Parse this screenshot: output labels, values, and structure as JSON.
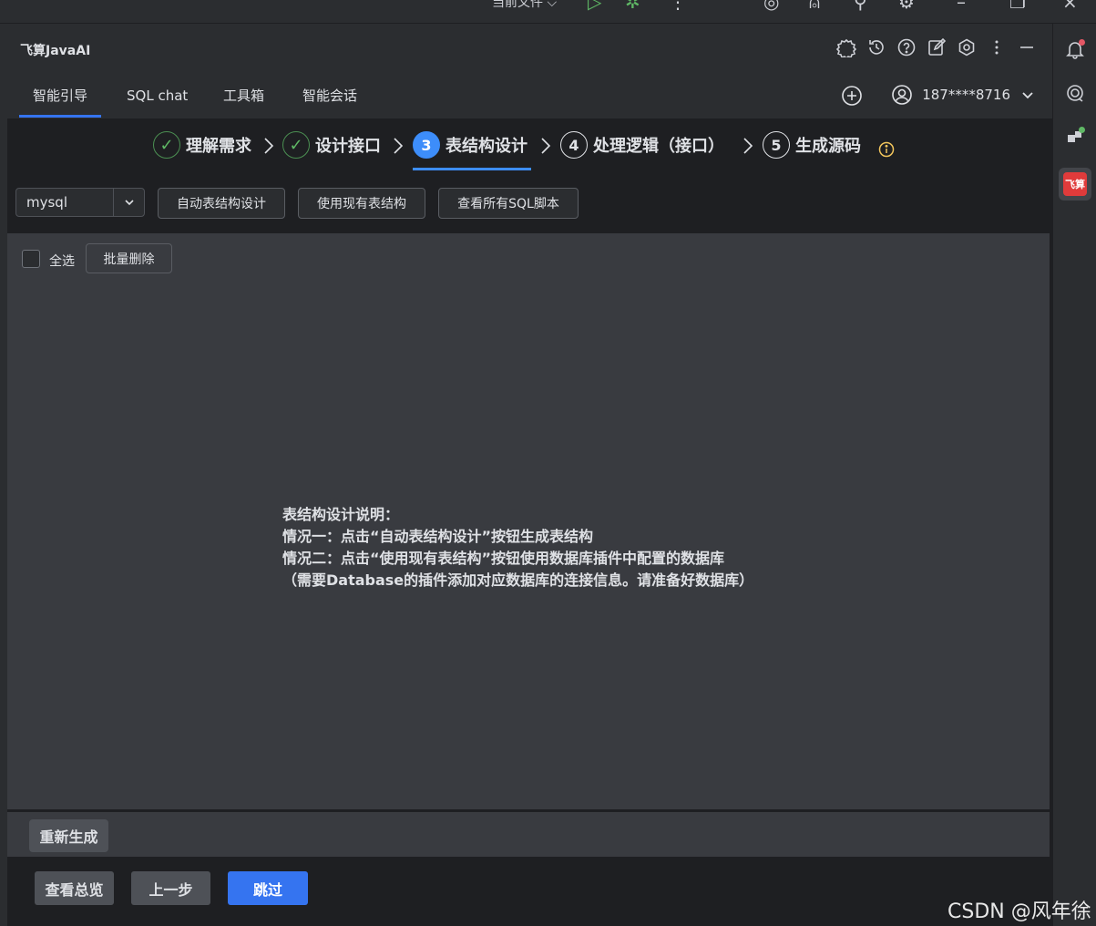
{
  "ide": {
    "run_target_label": "当前文件"
  },
  "panel": {
    "title": "飞算JavaAI"
  },
  "tabs": [
    {
      "label": "智能引导",
      "active": true
    },
    {
      "label": "SQL chat",
      "active": false
    },
    {
      "label": "工具箱",
      "active": false
    },
    {
      "label": "智能会话",
      "active": false
    }
  ],
  "account": {
    "phone": "187****8716"
  },
  "steps": [
    {
      "label": "理解需求",
      "state": "done",
      "marker": "✓"
    },
    {
      "label": "设计接口",
      "state": "done",
      "marker": "✓"
    },
    {
      "label": "表结构设计",
      "state": "current",
      "marker": "3"
    },
    {
      "label": "处理逻辑（接口）",
      "state": "todo",
      "marker": "4"
    },
    {
      "label": "生成源码",
      "state": "todo",
      "marker": "5"
    }
  ],
  "toolbar": {
    "db_select_value": "mysql",
    "auto_design_label": "自动表结构设计",
    "use_existing_label": "使用现有表结构",
    "view_sql_label": "查看所有SQL脚本"
  },
  "main": {
    "select_all_label": "全选",
    "batch_delete_label": "批量删除",
    "instructions": [
      "表结构设计说明：",
      "情况一：点击“自动表结构设计”按钮生成表结构",
      "情况二：点击“使用现有表结构”按钮使用数据库插件中配置的数据库",
      "（需要Database的插件添加对应数据库的连接信息。请准备好数据库）"
    ]
  },
  "regen": {
    "label": "重新生成"
  },
  "footer": {
    "overview_label": "查看总览",
    "prev_label": "上一步",
    "skip_label": "跳过"
  },
  "watermark": "CSDN @风年徐",
  "colors": {
    "accent": "#3574f0",
    "step_current": "#3d8dfa",
    "step_done": "#5fb865",
    "warning": "#f2c55c",
    "logo_red": "#e03b3b"
  }
}
